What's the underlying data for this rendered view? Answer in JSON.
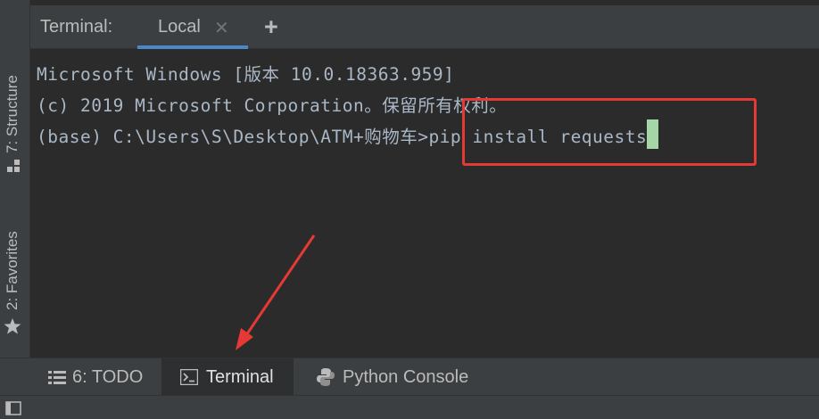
{
  "terminal_header": {
    "title": "Terminal:",
    "tab_label": "Local",
    "close_glyph": "✕",
    "add_glyph": "+"
  },
  "sidebar": {
    "items": [
      {
        "label": "7: Structure",
        "icon": "structure-icon"
      },
      {
        "label": "2: Favorites",
        "icon": "star-icon"
      }
    ]
  },
  "console": {
    "lines": [
      "Microsoft Windows [版本 10.0.18363.959]",
      "(c) 2019 Microsoft Corporation。保留所有权利。",
      "(base) C:\\Users\\S\\Desktop\\ATM+购物车"
    ],
    "command": ">pip install requests"
  },
  "bottom_tabs": [
    {
      "label": "6: TODO",
      "icon": "list-icon",
      "active": false
    },
    {
      "label": "Terminal",
      "icon": "terminal-icon",
      "active": true
    },
    {
      "label": "Python Console",
      "icon": "python-icon",
      "active": false
    }
  ],
  "colors": {
    "accent": "#4a88c7",
    "annotation": "#e53935",
    "cursor": "#a5d6a7"
  }
}
